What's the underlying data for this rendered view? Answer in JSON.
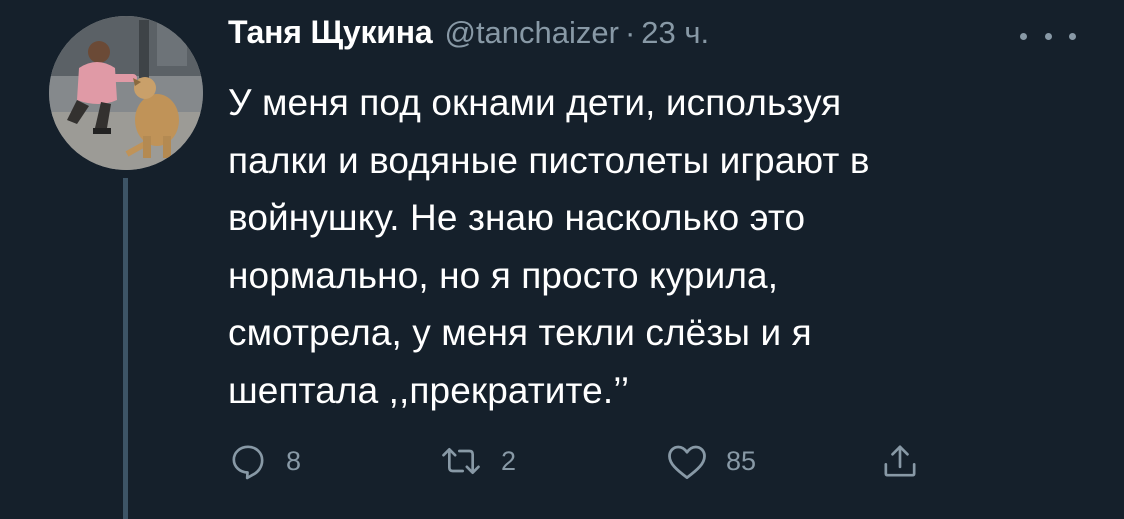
{
  "author": {
    "display_name": "Таня Щукина",
    "handle": "@tanchaizer",
    "separator": "·",
    "timestamp": "23 ч."
  },
  "tweet": {
    "lines": [
      "У меня под окнами дети, используя",
      "палки и водяные пистолеты играют в",
      "войнушку. Не знаю насколько это",
      "нормально, но я просто курила,",
      "смотрела, у меня текли слёзы и я",
      "шептала ,,прекратите.’’"
    ]
  },
  "actions": {
    "reply": {
      "icon": "reply-icon",
      "count": "8"
    },
    "retweet": {
      "icon": "retweet-icon",
      "count": "2"
    },
    "like": {
      "icon": "heart-icon",
      "count": "85"
    },
    "share": {
      "icon": "share-icon"
    }
  },
  "colors": {
    "background": "#15202b",
    "text": "#ffffff",
    "secondary": "#8899a6",
    "thread_line": "#3d5466"
  }
}
